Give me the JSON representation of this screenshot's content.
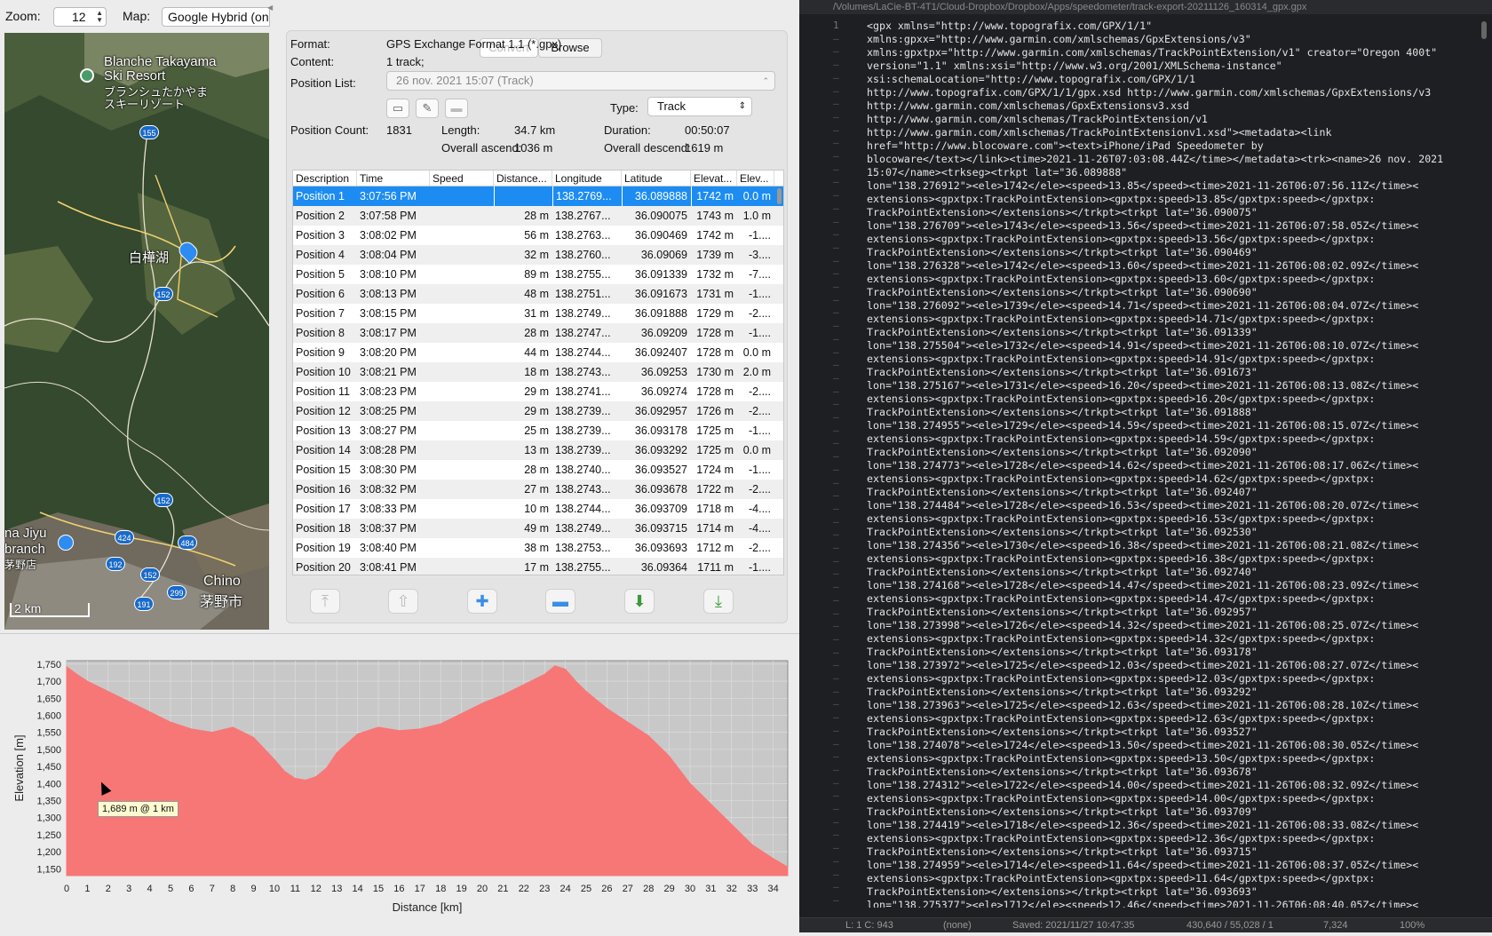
{
  "toolbar": {
    "zoom_label": "Zoom:",
    "zoom_value": "12",
    "map_label": "Map:",
    "map_value": "Google Hybrid (on"
  },
  "map": {
    "labels": [
      "Blanche Takayama",
      "Ski Resort",
      "ブランシュたかやま",
      "スキーリゾート",
      "白樺湖",
      "na Jiyu",
      "branch",
      "茅野店",
      "Chino",
      "茅野市"
    ],
    "scale": "2 km",
    "shields": [
      "155",
      "152",
      "152",
      "424",
      "484",
      "192",
      "152",
      "299",
      "191"
    ]
  },
  "segments": {
    "convert": "Convert",
    "browse": "Browse"
  },
  "info": {
    "format_label": "Format:",
    "format_value": "GPS Exchange Format 1.1 (*.gpx)",
    "content_label": "Content:",
    "content_value": "1 track;",
    "poslist_label": "Position List:",
    "poslist_value": "26 nov. 2021 15:07 (Track)",
    "type_label": "Type:",
    "type_value": "Track",
    "count_label": "Position Count:",
    "count_value": "1831",
    "length_label": "Length:",
    "length_value": "34.7 km",
    "duration_label": "Duration:",
    "duration_value": "00:50:07",
    "ascend_label": "Overall ascend:",
    "ascend_value": "1036 m",
    "descend_label": "Overall descend:",
    "descend_value": "1619 m"
  },
  "table": {
    "headers": [
      "Description",
      "Time",
      "Speed",
      "Distance...",
      "Longitude",
      "Latitude",
      "Elevat...",
      "Elev..."
    ],
    "rows": [
      [
        "Position 1",
        "3:07:56 PM",
        "",
        "",
        "138.2769...",
        "36.089888",
        "1742 m",
        "0.0 m"
      ],
      [
        "Position 2",
        "3:07:58 PM",
        "",
        "28 m",
        "138.2767...",
        "36.090075",
        "1743 m",
        "1.0 m"
      ],
      [
        "Position 3",
        "3:08:02 PM",
        "",
        "56 m",
        "138.2763...",
        "36.090469",
        "1742 m",
        "-1...."
      ],
      [
        "Position 4",
        "3:08:04 PM",
        "",
        "32 m",
        "138.2760...",
        "36.09069",
        "1739 m",
        "-3...."
      ],
      [
        "Position 5",
        "3:08:10 PM",
        "",
        "89 m",
        "138.2755...",
        "36.091339",
        "1732 m",
        "-7...."
      ],
      [
        "Position 6",
        "3:08:13 PM",
        "",
        "48 m",
        "138.2751...",
        "36.091673",
        "1731 m",
        "-1...."
      ],
      [
        "Position 7",
        "3:08:15 PM",
        "",
        "31 m",
        "138.2749...",
        "36.091888",
        "1729 m",
        "-2...."
      ],
      [
        "Position 8",
        "3:08:17 PM",
        "",
        "28 m",
        "138.2747...",
        "36.09209",
        "1728 m",
        "-1...."
      ],
      [
        "Position 9",
        "3:08:20 PM",
        "",
        "44 m",
        "138.2744...",
        "36.092407",
        "1728 m",
        "0.0 m"
      ],
      [
        "Position 10",
        "3:08:21 PM",
        "",
        "18 m",
        "138.2743...",
        "36.09253",
        "1730 m",
        "2.0 m"
      ],
      [
        "Position 11",
        "3:08:23 PM",
        "",
        "29 m",
        "138.2741...",
        "36.09274",
        "1728 m",
        "-2...."
      ],
      [
        "Position 12",
        "3:08:25 PM",
        "",
        "29 m",
        "138.2739...",
        "36.092957",
        "1726 m",
        "-2...."
      ],
      [
        "Position 13",
        "3:08:27 PM",
        "",
        "25 m",
        "138.2739...",
        "36.093178",
        "1725 m",
        "-1...."
      ],
      [
        "Position 14",
        "3:08:28 PM",
        "",
        "13 m",
        "138.2739...",
        "36.093292",
        "1725 m",
        "0.0 m"
      ],
      [
        "Position 15",
        "3:08:30 PM",
        "",
        "28 m",
        "138.2740...",
        "36.093527",
        "1724 m",
        "-1...."
      ],
      [
        "Position 16",
        "3:08:32 PM",
        "",
        "27 m",
        "138.2743...",
        "36.093678",
        "1722 m",
        "-2...."
      ],
      [
        "Position 17",
        "3:08:33 PM",
        "",
        "10 m",
        "138.2744...",
        "36.093709",
        "1718 m",
        "-4...."
      ],
      [
        "Position 18",
        "3:08:37 PM",
        "",
        "49 m",
        "138.2749...",
        "36.093715",
        "1714 m",
        "-4...."
      ],
      [
        "Position 19",
        "3:08:40 PM",
        "",
        "38 m",
        "138.2753...",
        "36.093693",
        "1712 m",
        "-2...."
      ],
      [
        "Position 20",
        "3:08:41 PM",
        "",
        "17 m",
        "138.2755...",
        "36.09364",
        "1711 m",
        "-1...."
      ]
    ]
  },
  "tooltip": "1,689 m @ 1 km",
  "chart_data": {
    "type": "area",
    "xlabel": "Distance [km]",
    "ylabel": "Elevation [m]",
    "ylim": [
      1130,
      1760
    ],
    "xlim": [
      0,
      34.7
    ],
    "yticks": [
      1150,
      1200,
      1250,
      1300,
      1350,
      1400,
      1450,
      1500,
      1550,
      1600,
      1650,
      1700,
      1750
    ],
    "xticks": [
      0,
      1,
      2,
      3,
      4,
      5,
      6,
      7,
      8,
      9,
      10,
      11,
      12,
      13,
      14,
      15,
      16,
      17,
      18,
      19,
      20,
      21,
      22,
      23,
      24,
      25,
      26,
      27,
      28,
      29,
      30,
      31,
      32,
      33,
      34
    ],
    "ytick_labels": [
      "1,150",
      "1,200",
      "1,250",
      "1,300",
      "1,350",
      "1,400",
      "1,450",
      "1,500",
      "1,550",
      "1,600",
      "1,650",
      "1,700",
      "1,750"
    ],
    "x": [
      0,
      0.5,
      1,
      2,
      3,
      4,
      5,
      6,
      7,
      8,
      9,
      10,
      10.5,
      11,
      11.5,
      12,
      12.5,
      13,
      14,
      15,
      16,
      17,
      18,
      19,
      20,
      21,
      22,
      23,
      23.5,
      24,
      24.5,
      25,
      26,
      27,
      28,
      29,
      30,
      31,
      32,
      33,
      34,
      34.7
    ],
    "y": [
      1742,
      1720,
      1700,
      1670,
      1640,
      1610,
      1580,
      1560,
      1550,
      1565,
      1535,
      1470,
      1435,
      1415,
      1410,
      1420,
      1445,
      1490,
      1545,
      1565,
      1555,
      1560,
      1575,
      1605,
      1635,
      1660,
      1690,
      1720,
      1745,
      1735,
      1700,
      1670,
      1620,
      1580,
      1540,
      1480,
      1400,
      1340,
      1280,
      1220,
      1180,
      1155
    ],
    "fill": "#f77776",
    "background": "#c8c8c8"
  },
  "editor": {
    "title": "/Volumes/LaCie-BT-4T1/Cloud-Dropbox/Dropbox/Apps/speedometer/track-export-20211126_160314_gpx.gpx",
    "line_number": "1",
    "lines": [
      "<gpx xmlns=\"http://www.topografix.com/GPX/1/1\"",
      "xmlns:gpxx=\"http://www.garmin.com/xmlschemas/GpxExtensions/v3\"",
      "xmlns:gpxtpx=\"http://www.garmin.com/xmlschemas/TrackPointExtension/v1\" creator=\"Oregon 400t\"",
      "version=\"1.1\" xmlns:xsi=\"http://www.w3.org/2001/XMLSchema-instance\"",
      "xsi:schemaLocation=\"http://www.topografix.com/GPX/1/1",
      "http://www.topografix.com/GPX/1/1/gpx.xsd http://www.garmin.com/xmlschemas/GpxExtensions/v3",
      "http://www.garmin.com/xmlschemas/GpxExtensionsv3.xsd",
      "http://www.garmin.com/xmlschemas/TrackPointExtension/v1",
      "http://www.garmin.com/xmlschemas/TrackPointExtensionv1.xsd\"><metadata><link",
      "href=\"http://www.blocoware.com\"><text>iPhone/iPad Speedometer by",
      "blocoware</text></link><time>2021-11-26T07:03:08.44Z</time></metadata><trk><name>26 nov. 2021",
      "15:07</name><trkseg><trkpt lat=\"36.089888\"",
      "lon=\"138.276912\"><ele>1742</ele><speed>13.85</speed><time>2021-11-26T06:07:56.11Z</time><",
      "extensions><gpxtpx:TrackPointExtension><gpxtpx:speed>13.85</gpxtpx:speed></gpxtpx:",
      "TrackPointExtension></extensions></trkpt><trkpt lat=\"36.090075\"",
      "lon=\"138.276709\"><ele>1743</ele><speed>13.56</speed><time>2021-11-26T06:07:58.05Z</time><",
      "extensions><gpxtpx:TrackPointExtension><gpxtpx:speed>13.56</gpxtpx:speed></gpxtpx:",
      "TrackPointExtension></extensions></trkpt><trkpt lat=\"36.090469\"",
      "lon=\"138.276328\"><ele>1742</ele><speed>13.60</speed><time>2021-11-26T06:08:02.09Z</time><",
      "extensions><gpxtpx:TrackPointExtension><gpxtpx:speed>13.60</gpxtpx:speed></gpxtpx:",
      "TrackPointExtension></extensions></trkpt><trkpt lat=\"36.090690\"",
      "lon=\"138.276092\"><ele>1739</ele><speed>14.71</speed><time>2021-11-26T06:08:04.07Z</time><",
      "extensions><gpxtpx:TrackPointExtension><gpxtpx:speed>14.71</gpxtpx:speed></gpxtpx:",
      "TrackPointExtension></extensions></trkpt><trkpt lat=\"36.091339\"",
      "lon=\"138.275504\"><ele>1732</ele><speed>14.91</speed><time>2021-11-26T06:08:10.07Z</time><",
      "extensions><gpxtpx:TrackPointExtension><gpxtpx:speed>14.91</gpxtpx:speed></gpxtpx:",
      "TrackPointExtension></extensions></trkpt><trkpt lat=\"36.091673\"",
      "lon=\"138.275167\"><ele>1731</ele><speed>16.20</speed><time>2021-11-26T06:08:13.08Z</time><",
      "extensions><gpxtpx:TrackPointExtension><gpxtpx:speed>16.20</gpxtpx:speed></gpxtpx:",
      "TrackPointExtension></extensions></trkpt><trkpt lat=\"36.091888\"",
      "lon=\"138.274955\"><ele>1729</ele><speed>14.59</speed><time>2021-11-26T06:08:15.07Z</time><",
      "extensions><gpxtpx:TrackPointExtension><gpxtpx:speed>14.59</gpxtpx:speed></gpxtpx:",
      "TrackPointExtension></extensions></trkpt><trkpt lat=\"36.092090\"",
      "lon=\"138.274773\"><ele>1728</ele><speed>14.62</speed><time>2021-11-26T06:08:17.06Z</time><",
      "extensions><gpxtpx:TrackPointExtension><gpxtpx:speed>14.62</gpxtpx:speed></gpxtpx:",
      "TrackPointExtension></extensions></trkpt><trkpt lat=\"36.092407\"",
      "lon=\"138.274484\"><ele>1728</ele><speed>16.53</speed><time>2021-11-26T06:08:20.07Z</time><",
      "extensions><gpxtpx:TrackPointExtension><gpxtpx:speed>16.53</gpxtpx:speed></gpxtpx:",
      "TrackPointExtension></extensions></trkpt><trkpt lat=\"36.092530\"",
      "lon=\"138.274356\"><ele>1730</ele><speed>16.38</speed><time>2021-11-26T06:08:21.08Z</time><",
      "extensions><gpxtpx:TrackPointExtension><gpxtpx:speed>16.38</gpxtpx:speed></gpxtpx:",
      "TrackPointExtension></extensions></trkpt><trkpt lat=\"36.092740\"",
      "lon=\"138.274168\"><ele>1728</ele><speed>14.47</speed><time>2021-11-26T06:08:23.09Z</time><",
      "extensions><gpxtpx:TrackPointExtension><gpxtpx:speed>14.47</gpxtpx:speed></gpxtpx:",
      "TrackPointExtension></extensions></trkpt><trkpt lat=\"36.092957\"",
      "lon=\"138.273998\"><ele>1726</ele><speed>14.32</speed><time>2021-11-26T06:08:25.07Z</time><",
      "extensions><gpxtpx:TrackPointExtension><gpxtpx:speed>14.32</gpxtpx:speed></gpxtpx:",
      "TrackPointExtension></extensions></trkpt><trkpt lat=\"36.093178\"",
      "lon=\"138.273972\"><ele>1725</ele><speed>12.03</speed><time>2021-11-26T06:08:27.07Z</time><",
      "extensions><gpxtpx:TrackPointExtension><gpxtpx:speed>12.03</gpxtpx:speed></gpxtpx:",
      "TrackPointExtension></extensions></trkpt><trkpt lat=\"36.093292\"",
      "lon=\"138.273963\"><ele>1725</ele><speed>12.63</speed><time>2021-11-26T06:08:28.10Z</time><",
      "extensions><gpxtpx:TrackPointExtension><gpxtpx:speed>12.63</gpxtpx:speed></gpxtpx:",
      "TrackPointExtension></extensions></trkpt><trkpt lat=\"36.093527\"",
      "lon=\"138.274078\"><ele>1724</ele><speed>13.50</speed><time>2021-11-26T06:08:30.05Z</time><",
      "extensions><gpxtpx:TrackPointExtension><gpxtpx:speed>13.50</gpxtpx:speed></gpxtpx:",
      "TrackPointExtension></extensions></trkpt><trkpt lat=\"36.093678\"",
      "lon=\"138.274312\"><ele>1722</ele><speed>14.00</speed><time>2021-11-26T06:08:32.09Z</time><",
      "extensions><gpxtpx:TrackPointExtension><gpxtpx:speed>14.00</gpxtpx:speed></gpxtpx:",
      "TrackPointExtension></extensions></trkpt><trkpt lat=\"36.093709\"",
      "lon=\"138.274419\"><ele>1718</ele><speed>12.36</speed><time>2021-11-26T06:08:33.08Z</time><",
      "extensions><gpxtpx:TrackPointExtension><gpxtpx:speed>12.36</gpxtpx:speed></gpxtpx:",
      "TrackPointExtension></extensions></trkpt><trkpt lat=\"36.093715\"",
      "lon=\"138.274959\"><ele>1714</ele><speed>11.64</speed><time>2021-11-26T06:08:37.05Z</time><",
      "extensions><gpxtpx:TrackPointExtension><gpxtpx:speed>11.64</gpxtpx:speed></gpxtpx:",
      "TrackPointExtension></extensions></trkpt><trkpt lat=\"36.093693\"",
      "lon=\"138.275377\"><ele>1712</ele><speed>12.46</speed><time>2021-11-26T06:08:40.05Z</time><"
    ],
    "status": {
      "position": "L: 1 C: 943",
      "syntax": "(none)",
      "saved": "Saved: 2021/11/27 10:47:35",
      "size": "430,640 / 55,028 / 1",
      "words": "7,324",
      "zoom": "100%"
    }
  }
}
